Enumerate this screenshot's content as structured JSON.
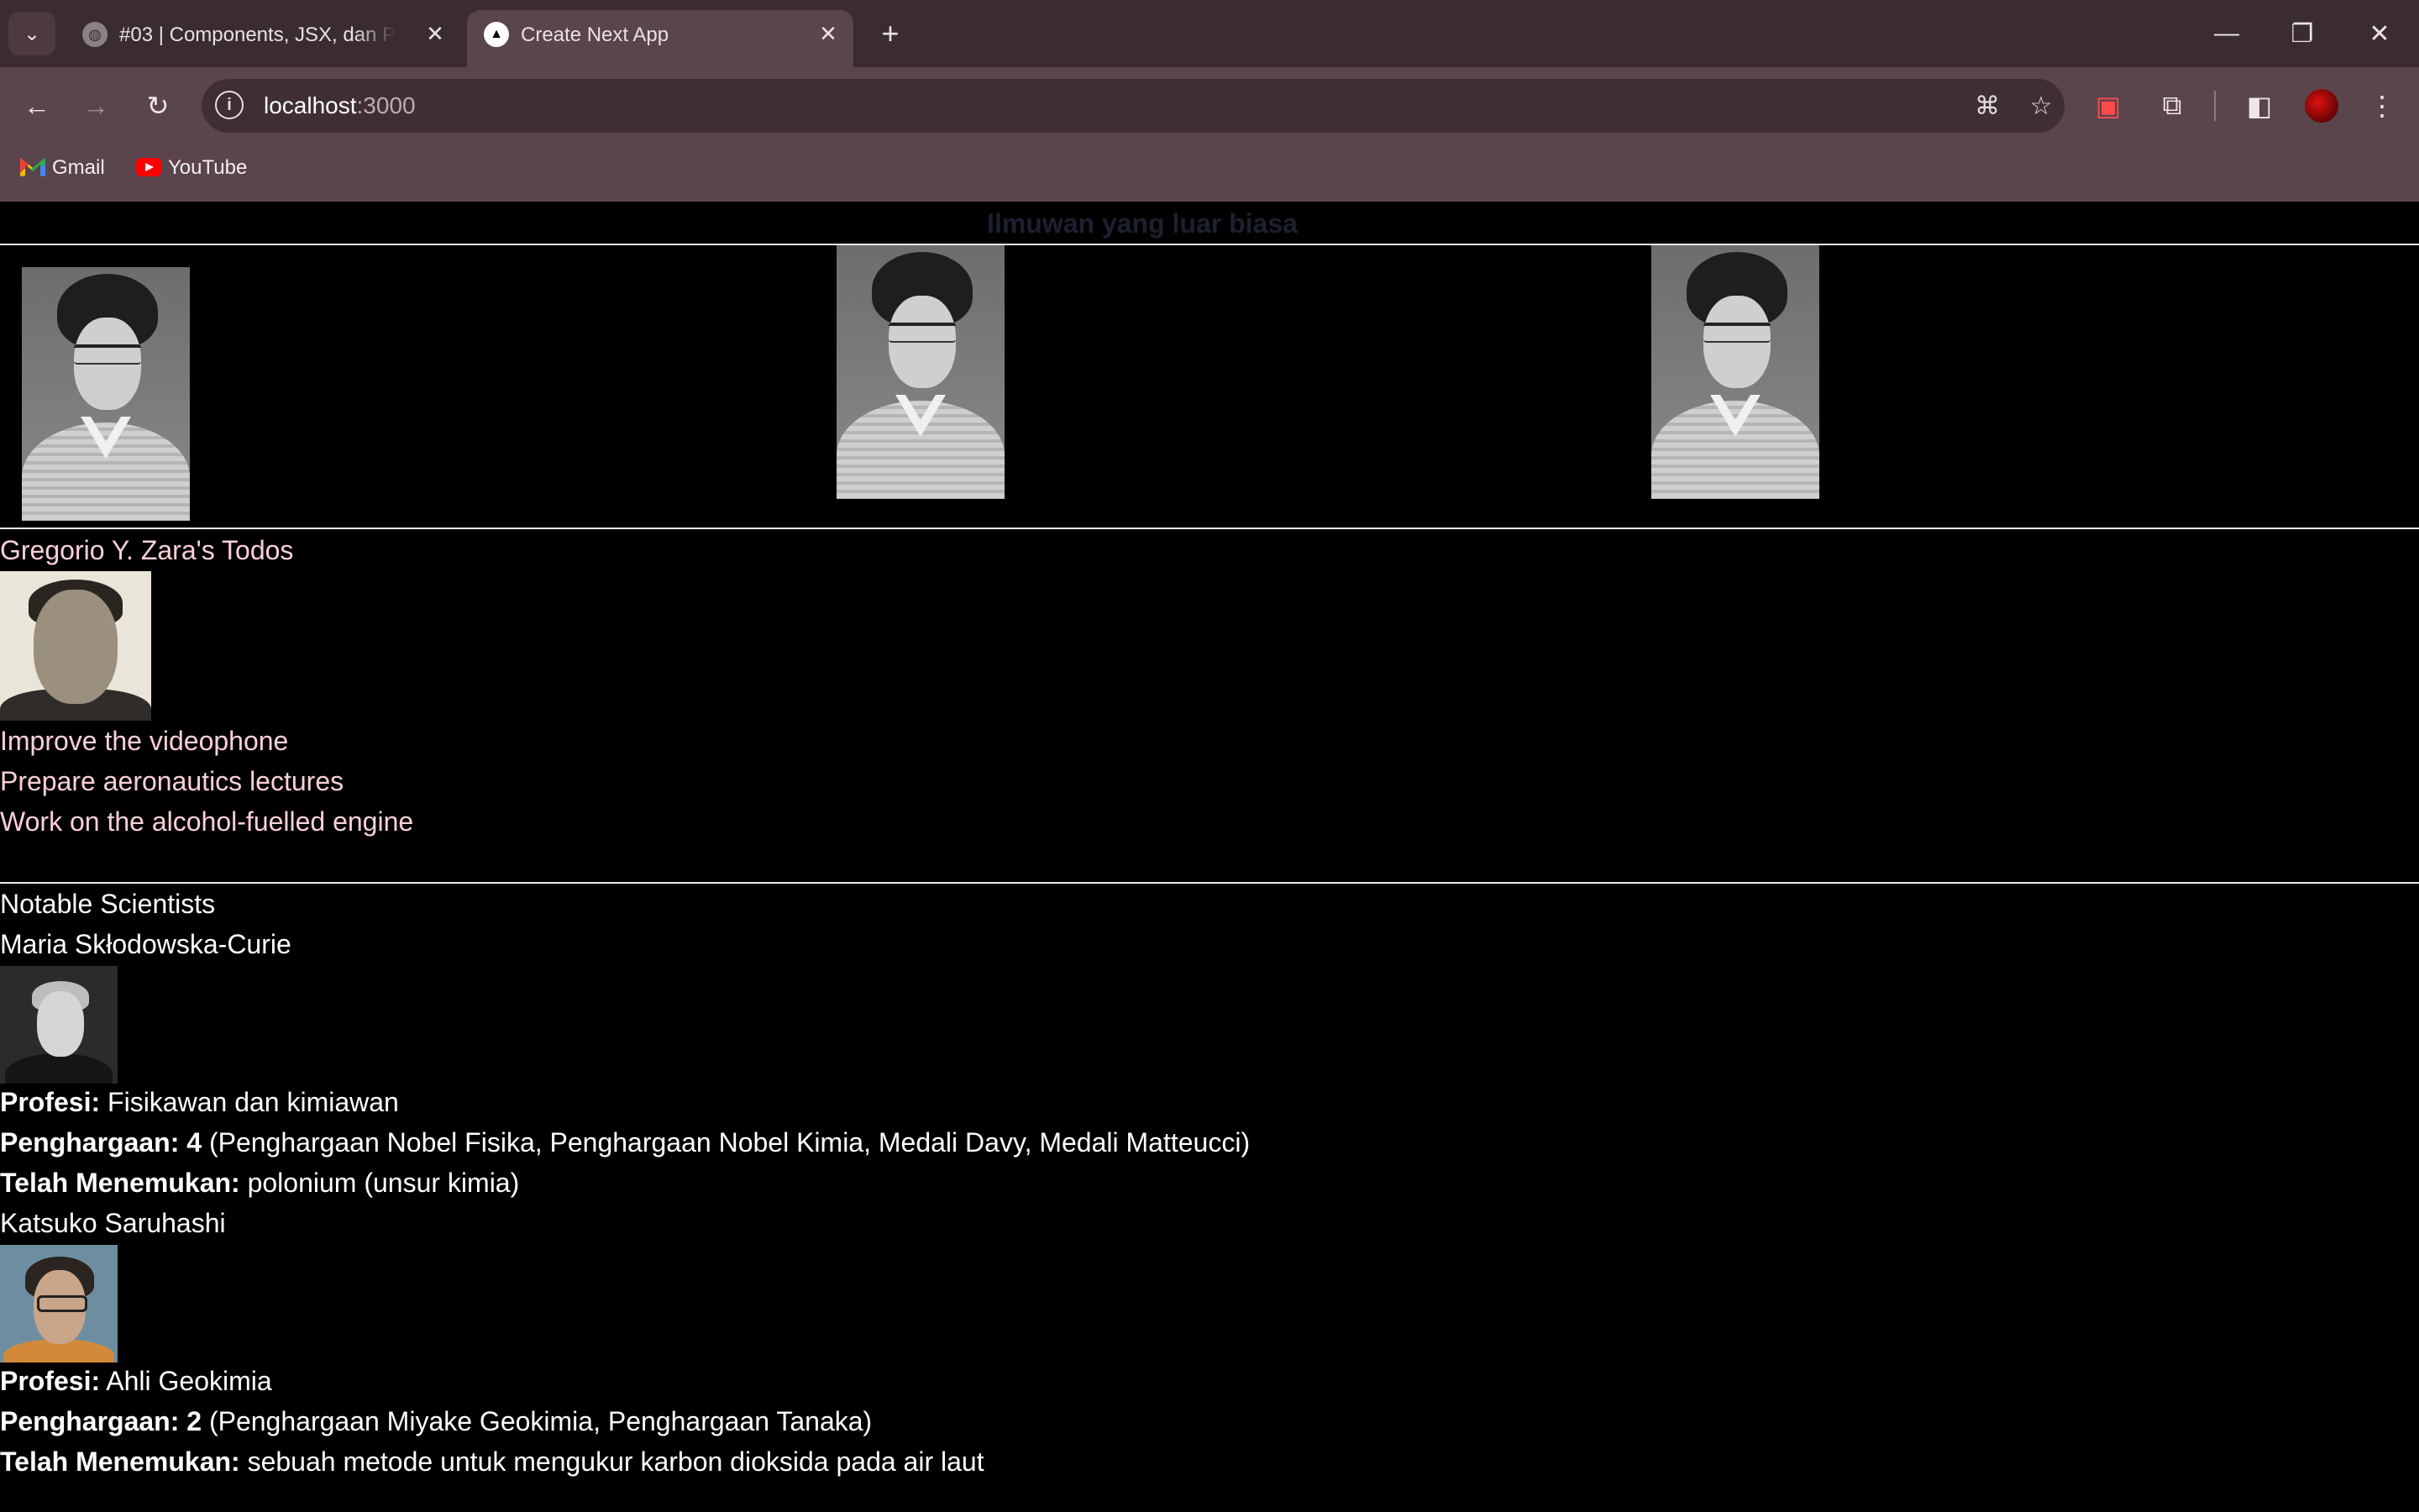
{
  "browser": {
    "tabs": [
      {
        "title": "#03 | Components, JSX, dan Props",
        "favicon": "globe-icon"
      },
      {
        "title": "Create Next App",
        "favicon": "nextjs-triangle-icon"
      }
    ],
    "omnibox": {
      "host": "localhost",
      "port": ":3000"
    },
    "bookmarks": [
      {
        "label": "Gmail",
        "icon": "gmail-icon"
      },
      {
        "label": "YouTube",
        "icon": "youtube-icon"
      }
    ]
  },
  "page": {
    "gallery_heading": "Ilmuwan yang luar biasa",
    "todos": {
      "title": "Gregorio Y. Zara's Todos",
      "items": [
        "Improve the videophone",
        "Prepare aeronautics lectures",
        "Work on the alcohol-fuelled engine"
      ]
    },
    "notable": {
      "title": "Notable Scientists",
      "scientists": [
        {
          "name": "Maria Skłodowska-Curie",
          "profession_label": "Profesi:",
          "profession": "Fisikawan dan kimiawan",
          "awards_label": "Penghargaan: 4",
          "awards": "(Penghargaan Nobel Fisika, Penghargaan Nobel Kimia, Medali Davy, Medali Matteucci)",
          "discovered_label": "Telah Menemukan:",
          "discovered": "polonium (unsur kimia)"
        },
        {
          "name": "Katsuko Saruhashi",
          "profession_label": "Profesi:",
          "profession": "Ahli Geokimia",
          "awards_label": "Penghargaan: 2",
          "awards": "(Penghargaan Miyake Geokimia, Penghargaan Tanaka)",
          "discovered_label": "Telah Menemukan:",
          "discovered": "sebuah metode untuk mengukur karbon dioksida pada air laut"
        }
      ]
    }
  },
  "colors": {
    "tabstrip": "#3a2c31",
    "toolbar": "#5a454d",
    "page_bg": "#000000",
    "todo_text": "#fbd0d8"
  }
}
